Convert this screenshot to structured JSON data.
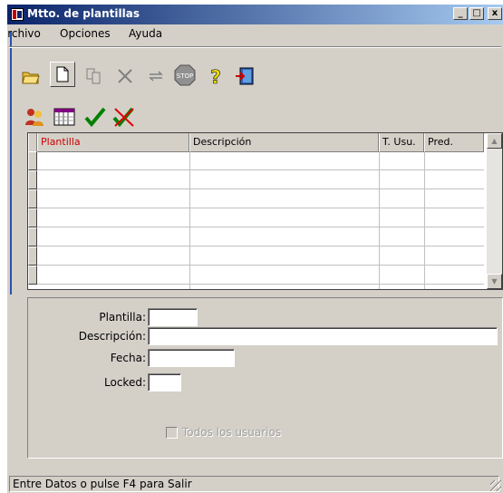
{
  "window": {
    "title": "Mtto. de plantillas"
  },
  "title_buttons": [
    {
      "name": "minimize-button",
      "icon": "minimize-icon",
      "glyph": "_"
    },
    {
      "name": "maximize-button",
      "icon": "maximize-icon",
      "glyph": "□"
    },
    {
      "name": "close-button",
      "icon": "close-icon",
      "glyph": "x"
    }
  ],
  "menu": {
    "items": [
      "Archivo",
      "Opciones",
      "Ayuda"
    ]
  },
  "toolbar": {
    "buttons": [
      "open-folder-icon",
      "new-document-icon",
      "copy-icon",
      "delete-x-icon",
      "replace-icon",
      "stop-icon",
      "help-icon",
      "exit-icon"
    ]
  },
  "toolbar2": {
    "buttons": [
      "users-icon",
      "columns-icon",
      "accept-check-icon",
      "cancel-check-icon"
    ]
  },
  "grid": {
    "columns": [
      "Plantilla",
      "Descripción",
      "T. Usu.",
      "Pred."
    ],
    "rows": 7
  },
  "form": {
    "plantilla_label": "Plantilla:",
    "plantilla_value": "",
    "descripcion_label": "Descripción:",
    "descripcion_value": "",
    "fecha_label": "Fecha:",
    "fecha_value": "",
    "locked_label": "Locked:",
    "locked_value": "",
    "todos_label": "Todos los usuarios",
    "todos_checked": false
  },
  "status": {
    "text": "Entre Datos o pulse F4 para Salir"
  },
  "colors": {
    "title_start": "#0a246a",
    "title_end": "#a6caf0",
    "face": "#d4d0c8",
    "header_accent": "#cc0000"
  }
}
